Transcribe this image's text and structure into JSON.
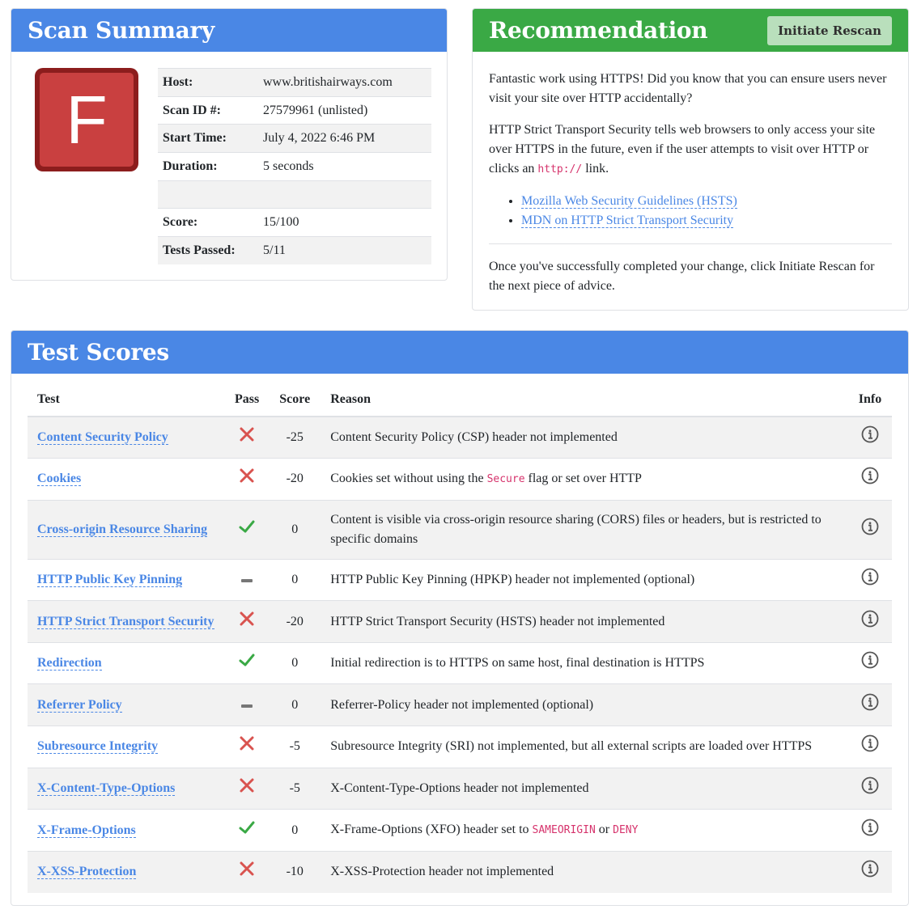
{
  "summary": {
    "title": "Scan Summary",
    "grade": "F",
    "rows": [
      {
        "label": "Host:",
        "value": "www.britishairways.com"
      },
      {
        "label": "Scan ID #:",
        "value": "27579961 (unlisted)"
      },
      {
        "label": "Start Time:",
        "value": "July 4, 2022 6:46 PM"
      },
      {
        "label": "Duration:",
        "value": "5 seconds"
      },
      {
        "label": "",
        "value": ""
      },
      {
        "label": "Score:",
        "value": "15/100"
      },
      {
        "label": "Tests Passed:",
        "value": "5/11"
      }
    ]
  },
  "recommendation": {
    "title": "Recommendation",
    "rescan_label": "Initiate Rescan",
    "p1": "Fantastic work using HTTPS! Did you know that you can ensure users never visit your site over HTTP accidentally?",
    "p2_before": "HTTP Strict Transport Security tells web browsers to only access your site over HTTPS in the future, even if the user attempts to visit over HTTP or clicks an ",
    "p2_code": "http://",
    "p2_after": " link.",
    "links": [
      "Mozilla Web Security Guidelines (HSTS)",
      "MDN on HTTP Strict Transport Security"
    ],
    "p3": "Once you've successfully completed your change, click Initiate Rescan for the next piece of advice."
  },
  "scores": {
    "title": "Test Scores",
    "columns": {
      "test": "Test",
      "pass": "Pass",
      "score": "Score",
      "reason": "Reason",
      "info": "Info"
    },
    "rows": [
      {
        "test": "Content Security Policy",
        "pass": "fail",
        "score": "-25",
        "reason": [
          "Content Security Policy (CSP) header not implemented"
        ]
      },
      {
        "test": "Cookies",
        "pass": "fail",
        "score": "-20",
        "reason": [
          "Cookies set without using the ",
          {
            "code": "Secure"
          },
          " flag or set over HTTP"
        ]
      },
      {
        "test": "Cross-origin Resource Sharing",
        "pass": "pass",
        "score": "0",
        "reason": [
          "Content is visible via cross-origin resource sharing (CORS) files or headers, but is restricted to specific domains"
        ]
      },
      {
        "test": "HTTP Public Key Pinning",
        "pass": "optional",
        "score": "0",
        "reason": [
          "HTTP Public Key Pinning (HPKP) header not implemented (optional)"
        ]
      },
      {
        "test": "HTTP Strict Transport Security",
        "pass": "fail",
        "score": "-20",
        "reason": [
          "HTTP Strict Transport Security (HSTS) header not implemented"
        ]
      },
      {
        "test": "Redirection",
        "pass": "pass",
        "score": "0",
        "reason": [
          "Initial redirection is to HTTPS on same host, final destination is HTTPS"
        ]
      },
      {
        "test": "Referrer Policy",
        "pass": "optional",
        "score": "0",
        "reason": [
          "Referrer-Policy header not implemented (optional)"
        ]
      },
      {
        "test": "Subresource Integrity",
        "pass": "fail",
        "score": "-5",
        "reason": [
          "Subresource Integrity (SRI) not implemented, but all external scripts are loaded over HTTPS"
        ]
      },
      {
        "test": "X-Content-Type-Options",
        "pass": "fail",
        "score": "-5",
        "reason": [
          "X-Content-Type-Options header not implemented"
        ]
      },
      {
        "test": "X-Frame-Options",
        "pass": "pass",
        "score": "0",
        "reason": [
          "X-Frame-Options (XFO) header set to ",
          {
            "code": "SAMEORIGIN"
          },
          " or ",
          {
            "code": "DENY"
          }
        ]
      },
      {
        "test": "X-XSS-Protection",
        "pass": "fail",
        "score": "-10",
        "reason": [
          "X-XSS-Protection header not implemented"
        ]
      }
    ]
  },
  "colors": {
    "blue_header": "#4a87e5",
    "green_header": "#3aa945",
    "fail": "#d9534f",
    "pass": "#3aa945",
    "optional": "#777777",
    "code": "#d6336c"
  }
}
